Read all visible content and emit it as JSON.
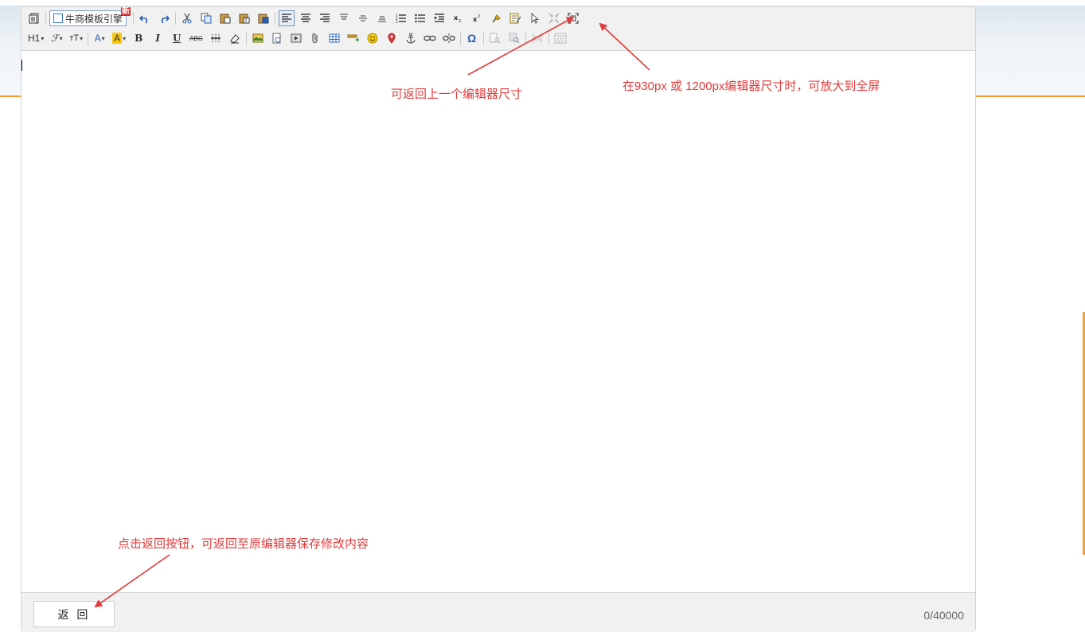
{
  "toolbar": {
    "template_button_label": "牛商模板引擎",
    "template_badge": "新",
    "heading_label": "H1",
    "font_family_label": "ℱ",
    "font_size_label": "тT",
    "font_color_label": "A",
    "highlight_label": "A",
    "bold_label": "B",
    "italic_label": "I",
    "underline_label": "U",
    "strike_label": "ABC",
    "special_char_label": "Ω"
  },
  "editor": {
    "back_button_label": "返 回",
    "word_count": "0/40000"
  },
  "annotations": {
    "restore_size": "可返回上一个编辑器尺寸",
    "fullscreen": "在930px 或 1200px编辑器尺寸时，可放大到全屏",
    "back_note": "点击返回按钮，可返回至原编辑器保存修改内容"
  },
  "colors": {
    "annotation_red": "#e23b3b",
    "accent_orange": "#f39b2f",
    "toolbar_bg": "#f1f1f1"
  }
}
